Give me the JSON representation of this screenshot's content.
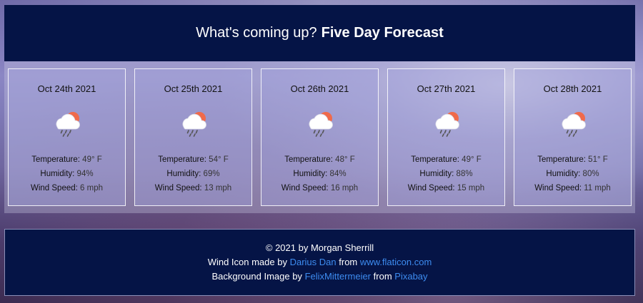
{
  "header": {
    "title_light": "What's coming up?",
    "title_bold": "Five Day Forecast"
  },
  "days": [
    {
      "date": "Oct 24th 2021",
      "temp_label": "Temperature:",
      "temp": "49° F",
      "humidity_label": "Humidity:",
      "humidity": "94%",
      "wind_label": "Wind Speed:",
      "wind": "6 mph",
      "icon": "cloud-rain-sun-icon"
    },
    {
      "date": "Oct 25th 2021",
      "temp_label": "Temperature:",
      "temp": "54° F",
      "humidity_label": "Humidity:",
      "humidity": "69%",
      "wind_label": "Wind Speed:",
      "wind": "13 mph",
      "icon": "cloud-rain-sun-icon"
    },
    {
      "date": "Oct 26th 2021",
      "temp_label": "Temperature:",
      "temp": "48° F",
      "humidity_label": "Humidity:",
      "humidity": "84%",
      "wind_label": "Wind Speed:",
      "wind": "16 mph",
      "icon": "cloud-rain-sun-icon"
    },
    {
      "date": "Oct 27th 2021",
      "temp_label": "Temperature:",
      "temp": "49° F",
      "humidity_label": "Humidity:",
      "humidity": "88%",
      "wind_label": "Wind Speed:",
      "wind": "15 mph",
      "icon": "cloud-rain-sun-icon"
    },
    {
      "date": "Oct 28th 2021",
      "temp_label": "Temperature:",
      "temp": "51° F",
      "humidity_label": "Humidity:",
      "humidity": "80%",
      "wind_label": "Wind Speed:",
      "wind": "11 mph",
      "icon": "cloud-rain-sun-icon"
    }
  ],
  "footer": {
    "copyright": "© 2021 by Morgan Sherrill",
    "icon_credit_prefix": "Wind Icon made by",
    "icon_author": "Darius Dan",
    "from_word": "from",
    "icon_site": "www.flaticon.com",
    "bg_credit_prefix": "Background Image by",
    "bg_author": "FelixMittermeier",
    "bg_from_word": "from",
    "bg_site": "Pixabay"
  },
  "colors": {
    "header_bg": "#051446",
    "link": "#3d8cf0",
    "sun": "#f06a4a"
  }
}
